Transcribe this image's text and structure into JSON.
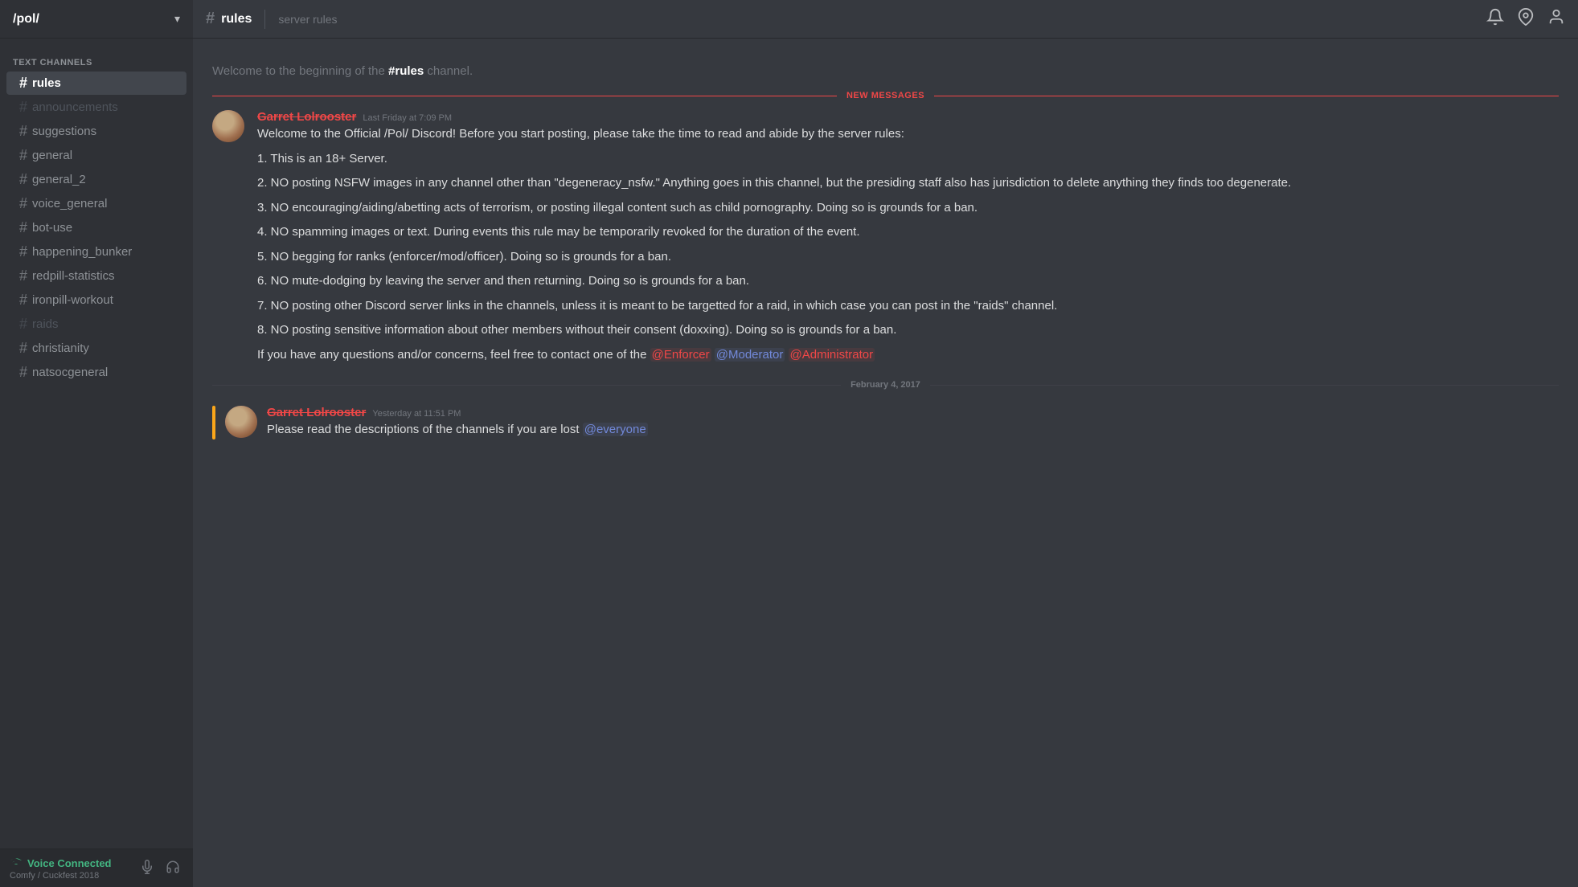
{
  "server": {
    "name": "/pol/",
    "chevron": "▾"
  },
  "sidebar": {
    "section_label": "TEXT CHANNELS",
    "channels": [
      {
        "id": "rules",
        "name": "rules",
        "active": true,
        "muted": false
      },
      {
        "id": "announcements",
        "name": "announcements",
        "active": false,
        "muted": true
      },
      {
        "id": "suggestions",
        "name": "suggestions",
        "active": false,
        "muted": false
      },
      {
        "id": "general",
        "name": "general",
        "active": false,
        "muted": false
      },
      {
        "id": "general_2",
        "name": "general_2",
        "active": false,
        "muted": false
      },
      {
        "id": "voice_general",
        "name": "voice_general",
        "active": false,
        "muted": false
      },
      {
        "id": "bot-use",
        "name": "bot-use",
        "active": false,
        "muted": false
      },
      {
        "id": "happening_bunker",
        "name": "happening_bunker",
        "active": false,
        "muted": false
      },
      {
        "id": "redpill-statistics",
        "name": "redpill-statistics",
        "active": false,
        "muted": false
      },
      {
        "id": "ironpill-workout",
        "name": "ironpill-workout",
        "active": false,
        "muted": false
      },
      {
        "id": "raids",
        "name": "raids",
        "active": false,
        "muted": true
      },
      {
        "id": "christianity",
        "name": "christianity",
        "active": false,
        "muted": false
      },
      {
        "id": "natsocgeneral",
        "name": "natsocgeneral",
        "active": false,
        "muted": false
      }
    ]
  },
  "voice_bar": {
    "label": "Voice Connected",
    "server_info": "Comfy / Cuckfest 2018",
    "signal_icon": "📶",
    "mic_icon": "🎤",
    "deafen_icon": "🎧"
  },
  "topbar": {
    "channel_name": "rules",
    "description": "server rules",
    "hash": "#",
    "bell_icon": "🔔",
    "pin_icon": "📌",
    "person_icon": "👤"
  },
  "chat": {
    "beginning_text": "Welcome to the beginning of the ",
    "beginning_channel": "#rules",
    "beginning_suffix": " channel.",
    "new_messages_label": "NEW MESSAGES",
    "messages": [
      {
        "id": "msg1",
        "author": "Garret Lolrooster",
        "timestamp": "Last Friday at 7:09 PM",
        "lines": [
          "Welcome to the Official /Pol/ Discord! Before you start posting, please take the time to read and abide by the server rules:",
          "",
          "1. This is an 18+ Server.",
          "",
          "2. NO posting NSFW images in any channel other than \"degeneracy_nsfw.\" Anything goes in this channel, but the presiding staff also has jurisdiction to delete anything they finds too degenerate.",
          "",
          "3. NO encouraging/aiding/abetting acts of terrorism, or posting illegal content such as child pornography. Doing so is grounds for a ban.",
          "",
          "4. NO spamming images or text. During events this rule may be temporarily revoked for the duration of the event.",
          "",
          "5. NO begging for ranks (enforcer/mod/officer). Doing so is grounds for a ban.",
          "",
          "6. NO mute-dodging by leaving the server and then returning. Doing so is grounds for a ban.",
          "",
          "7. NO posting other Discord server links in the channels, unless it is meant to be targetted for a raid, in which case you can post in the \"raids\" channel.",
          "",
          "8. NO posting sensitive information about other members without their consent (doxxing). Doing so is grounds for a ban.",
          "",
          "If you have any questions and/or concerns, feel free to contact one of the "
        ],
        "mentions": [
          {
            "text": "@Enforcer",
            "class": "mention-enforcer"
          },
          {
            "text": "@Moderator",
            "class": "mention-moderator"
          },
          {
            "text": "@Administrator",
            "class": "mention-administrator"
          }
        ]
      }
    ],
    "date_divider": "February 4, 2017",
    "second_message": {
      "author": "Garret Lolrooster",
      "timestamp": "Yesterday at 11:51 PM",
      "text_before": "Please read the descriptions of the channels if you are lost ",
      "mention": "@everyone",
      "mention_class": "mention-everyone"
    }
  }
}
